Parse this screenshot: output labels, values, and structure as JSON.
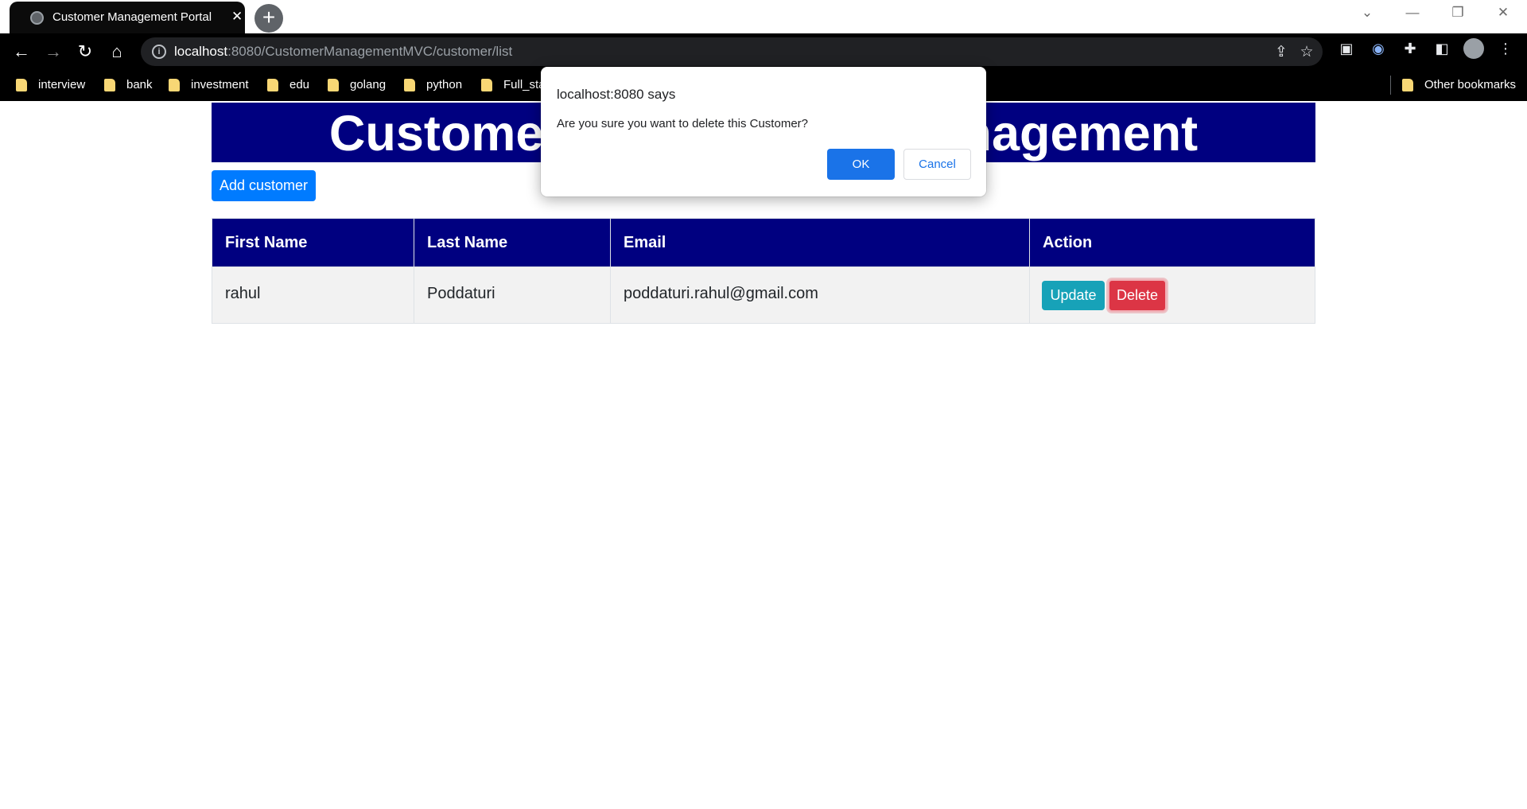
{
  "browser": {
    "tab_title": "Customer Management Portal",
    "tab_close": "✕",
    "new_tab": "+",
    "url_host": "localhost",
    "url_rest": ":8080/CustomerManagementMVC/customer/list",
    "bookmarks": [
      "interview",
      "bank",
      "investment",
      "edu",
      "golang",
      "python",
      "Full_sta"
    ],
    "other_bookmarks": "Other bookmarks"
  },
  "page": {
    "banner_title": "Customer Relationship Management",
    "add_button": "Add customer",
    "table": {
      "headers": [
        "First Name",
        "Last Name",
        "Email",
        "Action"
      ],
      "rows": [
        {
          "first_name": "rahul",
          "last_name": "Poddaturi",
          "email": "poddaturi.rahul@gmail.com",
          "update_label": "Update",
          "delete_label": "Delete"
        }
      ]
    }
  },
  "dialog": {
    "title": "localhost:8080 says",
    "message": "Are you sure you want to delete this Customer?",
    "ok_label": "OK",
    "cancel_label": "Cancel"
  },
  "colors": {
    "banner_bg": "#000080",
    "primary": "#007bff",
    "info": "#17a2b8",
    "danger": "#dc3545",
    "dialog_ok": "#1a73e8"
  }
}
